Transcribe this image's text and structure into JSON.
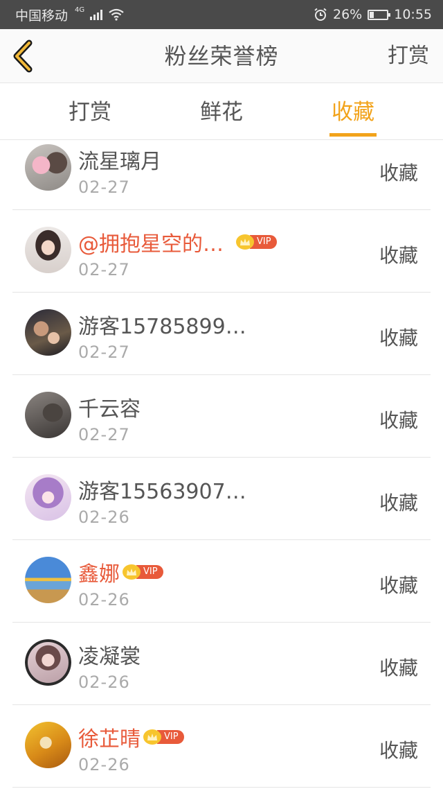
{
  "status_bar": {
    "carrier": "中国移动",
    "network": "4G",
    "battery": "26%",
    "battery_level": 0.26,
    "time": "10:55"
  },
  "header": {
    "title": "粉丝荣誉榜",
    "action_label": "打赏"
  },
  "tabs": [
    {
      "label": "打赏",
      "active": false
    },
    {
      "label": "鲜花",
      "active": false
    },
    {
      "label": "收藏",
      "active": true
    }
  ],
  "fans": [
    {
      "name": "流星璃月",
      "date": "02-27",
      "gift": "收藏",
      "vip": false
    },
    {
      "name": "@拥抱星空的…",
      "date": "02-27",
      "gift": "收藏",
      "vip": true,
      "vip_label": "VIP"
    },
    {
      "name": "游客15785899…",
      "date": "02-27",
      "gift": "收藏",
      "vip": false
    },
    {
      "name": "千云容",
      "date": "02-27",
      "gift": "收藏",
      "vip": false
    },
    {
      "name": "游客15563907…",
      "date": "02-26",
      "gift": "收藏",
      "vip": false
    },
    {
      "name": "鑫娜",
      "date": "02-26",
      "gift": "收藏",
      "vip": true,
      "vip_label": "VIP"
    },
    {
      "name": "凌凝裳",
      "date": "02-26",
      "gift": "收藏",
      "vip": false
    },
    {
      "name": "徐芷晴",
      "date": "02-26",
      "gift": "收藏",
      "vip": true,
      "vip_label": "VIP"
    }
  ],
  "colors": {
    "accent": "#f2a31b",
    "vip_name": "#e85a3a"
  }
}
